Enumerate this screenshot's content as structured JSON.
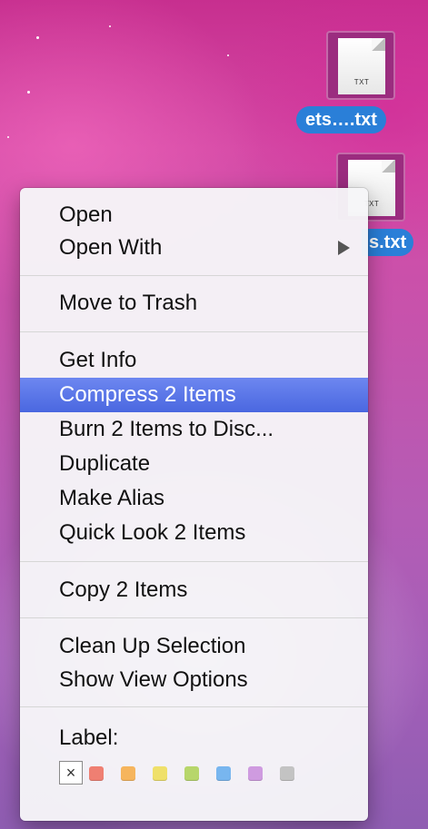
{
  "desktop": {
    "files": [
      {
        "name": "ets….txt",
        "type_label": "TXT"
      },
      {
        "name": "s.txt",
        "type_label": "TXT"
      }
    ]
  },
  "menu": {
    "groups": [
      {
        "items": [
          {
            "label": "Open"
          },
          {
            "label": "Open With",
            "has_submenu": true
          }
        ]
      },
      {
        "items": [
          {
            "label": "Move to Trash"
          }
        ]
      },
      {
        "items": [
          {
            "label": "Get Info"
          },
          {
            "label": "Compress 2 Items",
            "highlighted": true
          },
          {
            "label": "Burn 2 Items to Disc..."
          },
          {
            "label": "Duplicate"
          },
          {
            "label": "Make Alias"
          },
          {
            "label": "Quick Look 2 Items"
          }
        ]
      },
      {
        "items": [
          {
            "label": "Copy 2 Items"
          }
        ]
      },
      {
        "items": [
          {
            "label": "Clean Up Selection"
          },
          {
            "label": "Show View Options"
          }
        ]
      }
    ],
    "label_section": {
      "title": "Label:",
      "none_symbol": "×",
      "colors": [
        {
          "name": "red",
          "hex": "#ef7f72"
        },
        {
          "name": "orange",
          "hex": "#f6b55d"
        },
        {
          "name": "yellow",
          "hex": "#efe06a"
        },
        {
          "name": "green",
          "hex": "#b7d66b"
        },
        {
          "name": "blue",
          "hex": "#78b6ef"
        },
        {
          "name": "purple",
          "hex": "#cf9be0"
        },
        {
          "name": "gray",
          "hex": "#c3c3c3"
        }
      ]
    }
  },
  "colors": {
    "highlight": "#4a67e0",
    "selection_label": "#2a7fd8"
  }
}
